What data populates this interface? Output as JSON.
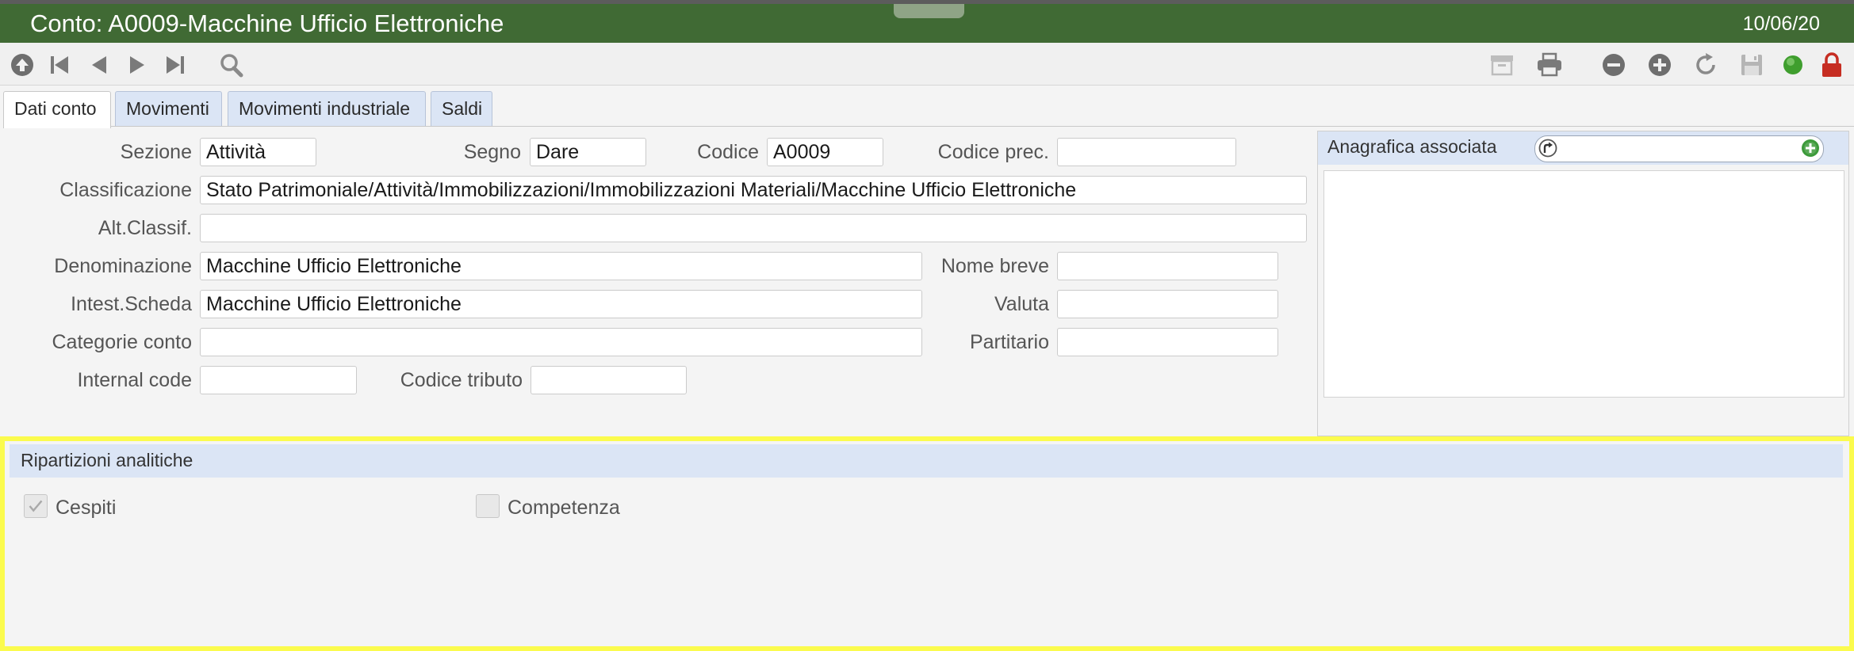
{
  "window": {
    "title": "Conto: A0009-Macchine Ufficio Elettroniche",
    "date": "10/06/20"
  },
  "toolbar": {
    "left_icons": [
      "up-circle-icon",
      "first-record-icon",
      "previous-icon",
      "next-icon",
      "last-record-icon",
      "search-icon"
    ],
    "right_icons": [
      "archive-icon",
      "print-icon",
      "remove-icon",
      "add-icon",
      "refresh-icon",
      "save-icon",
      "status-green-icon",
      "lock-icon"
    ]
  },
  "tabs": [
    {
      "label": "Dati conto",
      "active": true
    },
    {
      "label": "Movimenti",
      "active": false
    },
    {
      "label": "Movimenti industriale",
      "active": false
    },
    {
      "label": "Saldi",
      "active": false
    }
  ],
  "form": {
    "sezione": {
      "label": "Sezione",
      "value": "Attività"
    },
    "segno": {
      "label": "Segno",
      "value": "Dare"
    },
    "codice": {
      "label": "Codice",
      "value": "A0009"
    },
    "codice_prec": {
      "label": "Codice prec.",
      "value": ""
    },
    "classificazione": {
      "label": "Classificazione",
      "value": "Stato Patrimoniale/Attività/Immobilizzazioni/Immobilizzazioni Materiali/Macchine Ufficio Elettroniche"
    },
    "alt_classif": {
      "label": "Alt.Classif.",
      "value": ""
    },
    "denominazione": {
      "label": "Denominazione",
      "value": "Macchine Ufficio Elettroniche"
    },
    "nome_breve": {
      "label": "Nome breve",
      "value": ""
    },
    "intest_scheda": {
      "label": "Intest.Scheda",
      "value": "Macchine Ufficio Elettroniche"
    },
    "valuta": {
      "label": "Valuta",
      "value": ""
    },
    "categorie_conto": {
      "label": "Categorie conto",
      "value": ""
    },
    "partitario": {
      "label": "Partitario",
      "value": ""
    },
    "internal_code": {
      "label": "Internal code",
      "value": ""
    },
    "codice_tributo": {
      "label": "Codice tributo",
      "value": ""
    }
  },
  "anagrafica": {
    "title": "Anagrafica associata",
    "value": ""
  },
  "ripartizioni": {
    "title": "Ripartizioni analitiche",
    "cespiti": {
      "label": "Cespiti",
      "checked": true
    },
    "competenza": {
      "label": "Competenza",
      "checked": false
    }
  },
  "colors": {
    "title_bar": "#406a34",
    "tab_background": "#dbe5f5",
    "highlight_border": "#fbfb4d",
    "status_green": "#3f9e2e",
    "lock_red": "#c62d22"
  }
}
